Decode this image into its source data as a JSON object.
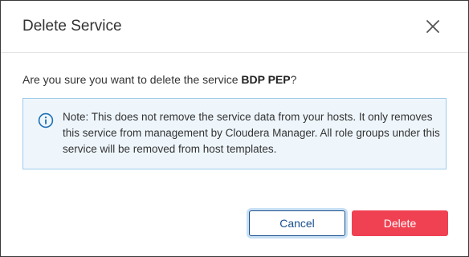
{
  "dialog": {
    "title": "Delete Service",
    "question_prefix": "Are you sure you want to delete the service ",
    "service_name": "BDP PEP",
    "question_suffix": "?",
    "note": "Note: This does not remove the service data from your hosts. It only removes this service from management by Cloudera Manager. All role groups under this service will be removed from host templates.",
    "buttons": {
      "cancel": "Cancel",
      "delete": "Delete"
    }
  },
  "icons": {
    "close": "close-icon",
    "info": "info-icon"
  },
  "colors": {
    "note_background": "#eef6fc",
    "note_border": "#9fcbe8",
    "info_icon": "#1c6fb5",
    "cancel_border": "#1a4f8b",
    "delete_background": "#f04152"
  }
}
